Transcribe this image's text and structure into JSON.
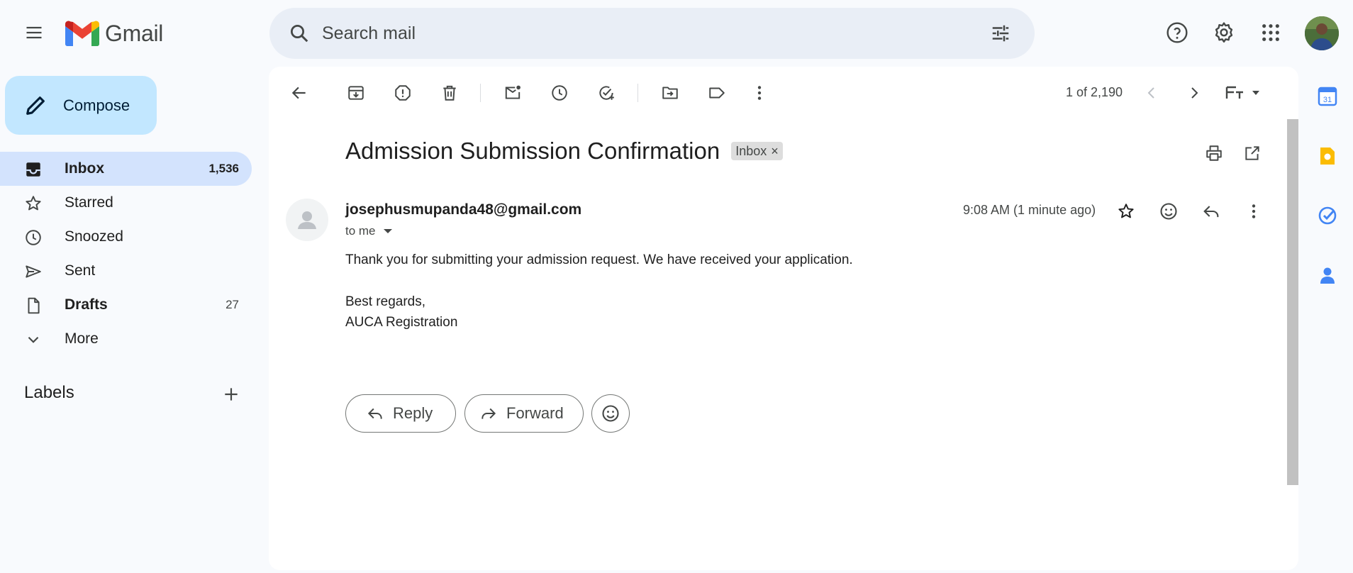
{
  "header": {
    "app_name": "Gmail",
    "search": {
      "placeholder": "Search mail"
    }
  },
  "sidebar": {
    "compose_label": "Compose",
    "items": [
      {
        "label": "Inbox",
        "count": "1,536",
        "icon": "inbox-icon"
      },
      {
        "label": "Starred",
        "count": "",
        "icon": "star-icon"
      },
      {
        "label": "Snoozed",
        "count": "",
        "icon": "clock-icon"
      },
      {
        "label": "Sent",
        "count": "",
        "icon": "send-icon"
      },
      {
        "label": "Drafts",
        "count": "27",
        "icon": "draft-icon"
      },
      {
        "label": "More",
        "count": "",
        "icon": "chevron-down-icon"
      }
    ],
    "labels_heading": "Labels"
  },
  "toolbar": {
    "pager": "1 of 2,190"
  },
  "message": {
    "subject": "Admission Submission Confirmation",
    "label_badge": "Inbox",
    "badge_remove": "×",
    "sender": "josephusmupanda48@gmail.com",
    "recipient": "to me",
    "time": "9:08 AM (1 minute ago)",
    "body": [
      "Thank you for submitting your admission request. We have received your application.",
      "Best regards,",
      "AUCA Registration"
    ]
  },
  "actions": {
    "reply_label": "Reply",
    "forward_label": "Forward"
  },
  "side_panel": {
    "calendar_day": "31"
  },
  "colors": {
    "background": "#f8fafd",
    "compose": "#c2e7ff",
    "active_nav": "#d3e3fd",
    "search_bg": "#e9eef6",
    "calendar": "#4285f4",
    "keep": "#fbbc04",
    "tasks": "#4285f4",
    "contacts": "#4285f4"
  }
}
